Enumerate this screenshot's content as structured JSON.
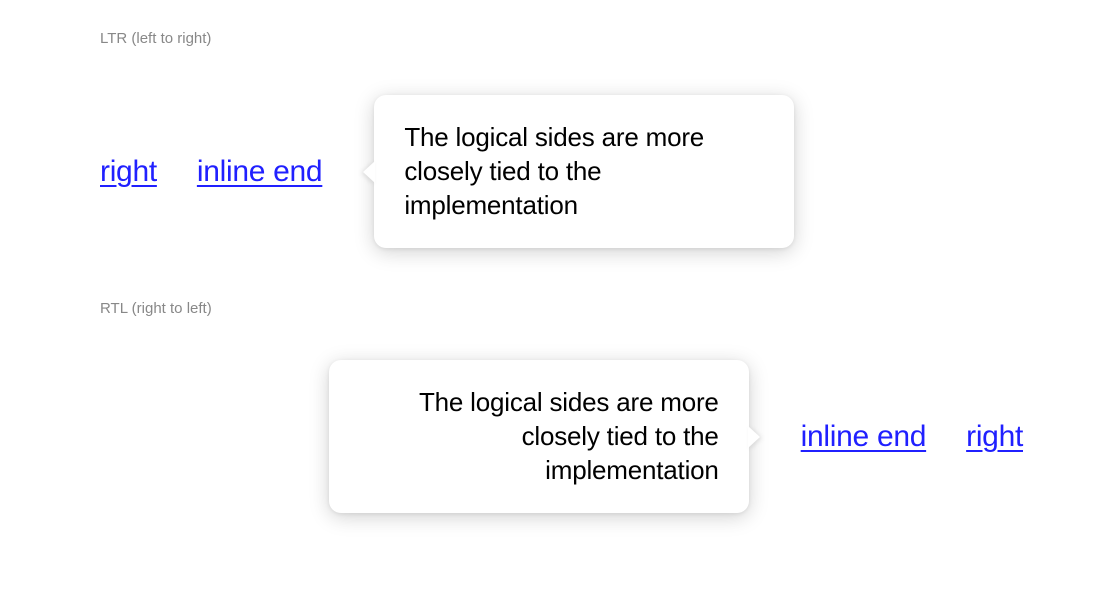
{
  "sections": {
    "ltr": {
      "label": "LTR (left to right)",
      "link_right": "right",
      "link_inline_end": "inline end",
      "tooltip_text": "The logical sides are more closely tied to the implementation"
    },
    "rtl": {
      "label": "RTL (right to left)",
      "link_right": "right",
      "link_inline_end": "inline end",
      "tooltip_text": "The logical sides are more closely tied to the implementation"
    }
  },
  "colors": {
    "link": "#2020ff",
    "label": "#888888",
    "text": "#000000",
    "background": "#ffffff"
  }
}
